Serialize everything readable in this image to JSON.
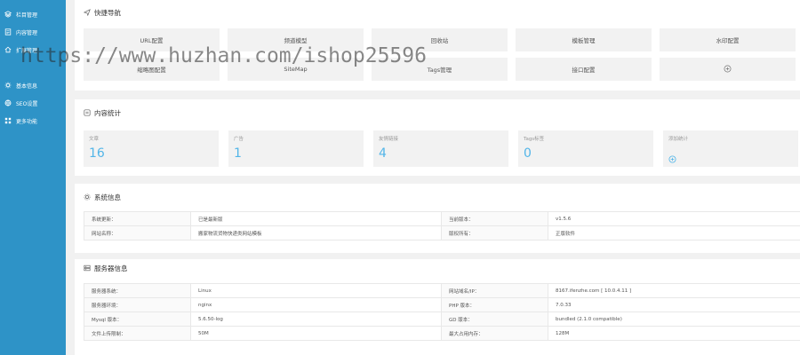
{
  "sidebar": {
    "items": [
      {
        "label": "栏目管理",
        "icon": "layers-icon"
      },
      {
        "label": "内容管理",
        "icon": "document-icon"
      },
      {
        "label": "扩展管理",
        "icon": "home-icon"
      },
      {
        "label": "",
        "icon": "blank"
      },
      {
        "label": "基本信息",
        "icon": "gear-icon"
      },
      {
        "label": "SEO设置",
        "icon": "globe-icon"
      },
      {
        "label": "更多功能",
        "icon": "grid-icon"
      }
    ]
  },
  "quick_nav": {
    "title": "快捷导航",
    "items": [
      "URL配置",
      "频道模型",
      "回收站",
      "模板管理",
      "水印配置",
      "缩略图配置",
      "SiteMap",
      "Tags管理",
      "接口配置"
    ]
  },
  "content_stats": {
    "title": "内容统计",
    "cards": [
      {
        "label": "文章",
        "value": "16"
      },
      {
        "label": "广告",
        "value": "1"
      },
      {
        "label": "友情链接",
        "value": "4"
      },
      {
        "label": "Tags标签",
        "value": "0"
      },
      {
        "label": "添加统计",
        "value": ""
      }
    ]
  },
  "system_info": {
    "title": "系统信息",
    "rows": [
      [
        "系统更新：",
        "已是最新版",
        "当前版本：",
        "v1.5.6"
      ],
      [
        "网站名称：",
        "搬家物流货物快递类网站模板",
        "版权所有：",
        "正版软件"
      ]
    ]
  },
  "server_info": {
    "title": "服务器信息",
    "rows": [
      [
        "服务器系统：",
        "Linux",
        "网站域名/IP：",
        "8167.ifenzhe.com [ 10.0.4.11 ]"
      ],
      [
        "服务器环境：",
        "nginx",
        "PHP 版本：",
        "7.0.33"
      ],
      [
        "Mysql 版本：",
        "5.6.50-log",
        "GD 版本：",
        "bundled (2.1.0 compatible)"
      ],
      [
        "文件上传限制：",
        "50M",
        "最大占用内存：",
        "128M"
      ]
    ]
  },
  "watermark": "https://www.huzhan.com/ishop25596",
  "colors": {
    "sidebar": "#2e93c7",
    "accent": "#52b5e8",
    "background": "#f1f1f1"
  }
}
